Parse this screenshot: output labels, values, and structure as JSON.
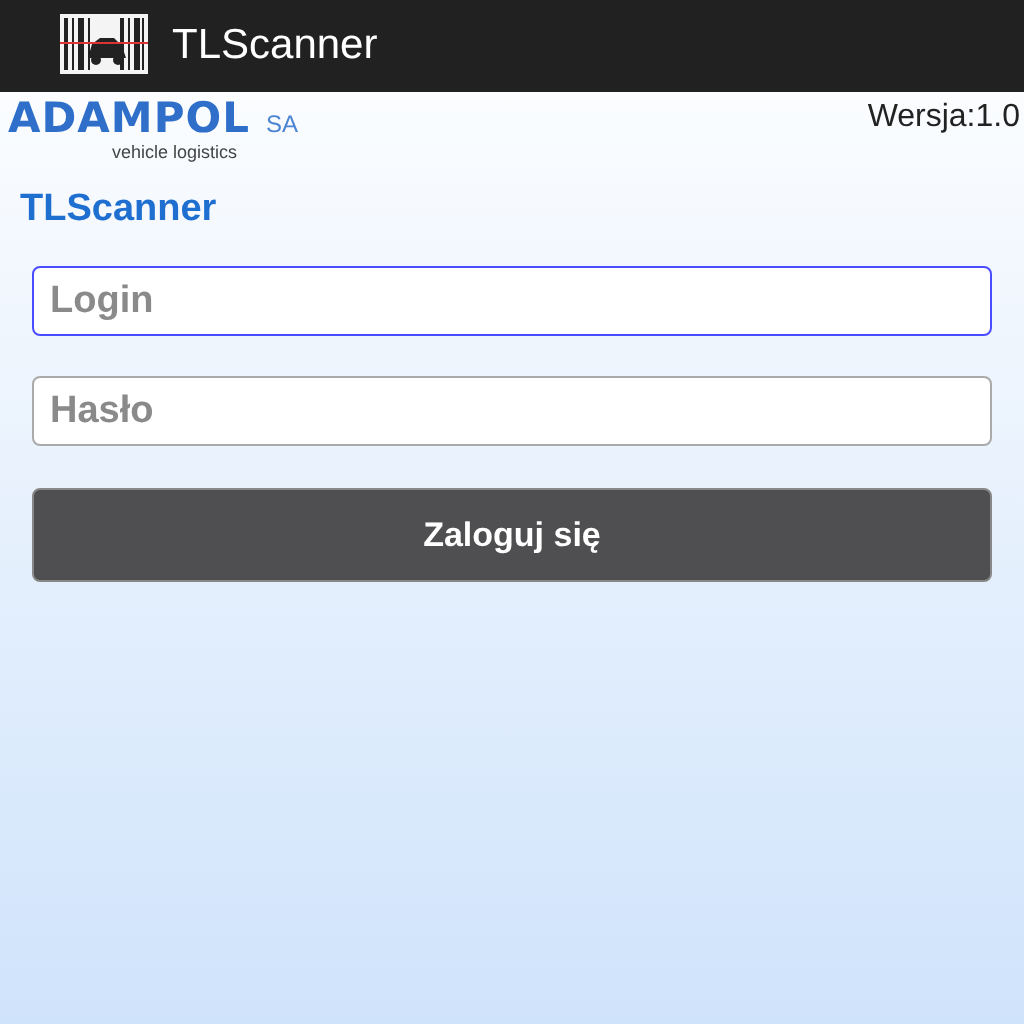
{
  "action_bar": {
    "title": "TLScanner"
  },
  "logo": {
    "name": "ADAMPOL",
    "suffix": "SA",
    "tagline": "vehicle logistics"
  },
  "version": "Wersja:1.0",
  "heading": "TLScanner",
  "fields": [
    {
      "placeholder": "Login",
      "focused": true
    },
    {
      "placeholder": "Hasło",
      "focused": false
    }
  ],
  "button": "Zaloguj się"
}
